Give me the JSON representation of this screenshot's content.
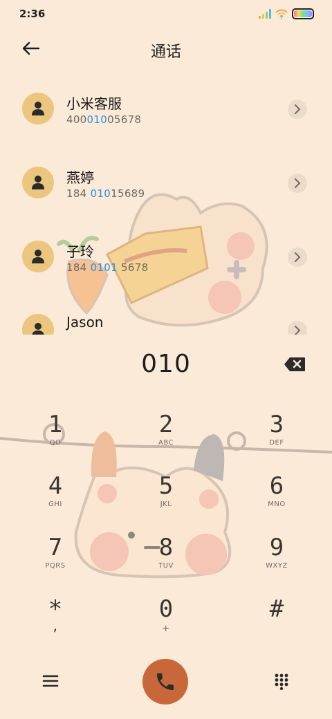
{
  "status": {
    "time": "2:36"
  },
  "header": {
    "title": "通话"
  },
  "contacts": [
    {
      "name": "小米客服",
      "num_pre": "400",
      "num_hl": "010",
      "num_post": "05678"
    },
    {
      "name": "燕婷",
      "num_pre": "184 ",
      "num_hl": "010",
      "num_post": "15689"
    },
    {
      "name": "子玲",
      "num_pre": "184 ",
      "num_hl": "0101",
      "num_post": " 5678"
    },
    {
      "name": "Jason",
      "num_pre": "",
      "num_hl": "",
      "num_post": ""
    }
  ],
  "dialer": {
    "input": "010"
  },
  "keys": [
    {
      "digit": "1",
      "letters": "QO"
    },
    {
      "digit": "2",
      "letters": "ABC"
    },
    {
      "digit": "3",
      "letters": "DEF"
    },
    {
      "digit": "4",
      "letters": "GHI"
    },
    {
      "digit": "5",
      "letters": "JKL"
    },
    {
      "digit": "6",
      "letters": "MNO"
    },
    {
      "digit": "7",
      "letters": "PQRS"
    },
    {
      "digit": "8",
      "letters": "TUV"
    },
    {
      "digit": "9",
      "letters": "WXYZ"
    },
    {
      "digit": "*",
      "letters": ","
    },
    {
      "digit": "0",
      "letters": "+"
    },
    {
      "digit": "#",
      "letters": ""
    }
  ],
  "icons": {
    "back": "arrow-left-icon",
    "avatar": "person-icon",
    "detail": "chevron-right-icon",
    "backspace": "backspace-icon",
    "menu": "menu-icon",
    "call": "phone-icon",
    "keypad": "dialpad-icon"
  },
  "colors": {
    "background": "#fbead8",
    "accent": "#c8683a",
    "highlight": "#2e8fd8",
    "avatar": "#ecc57f"
  }
}
